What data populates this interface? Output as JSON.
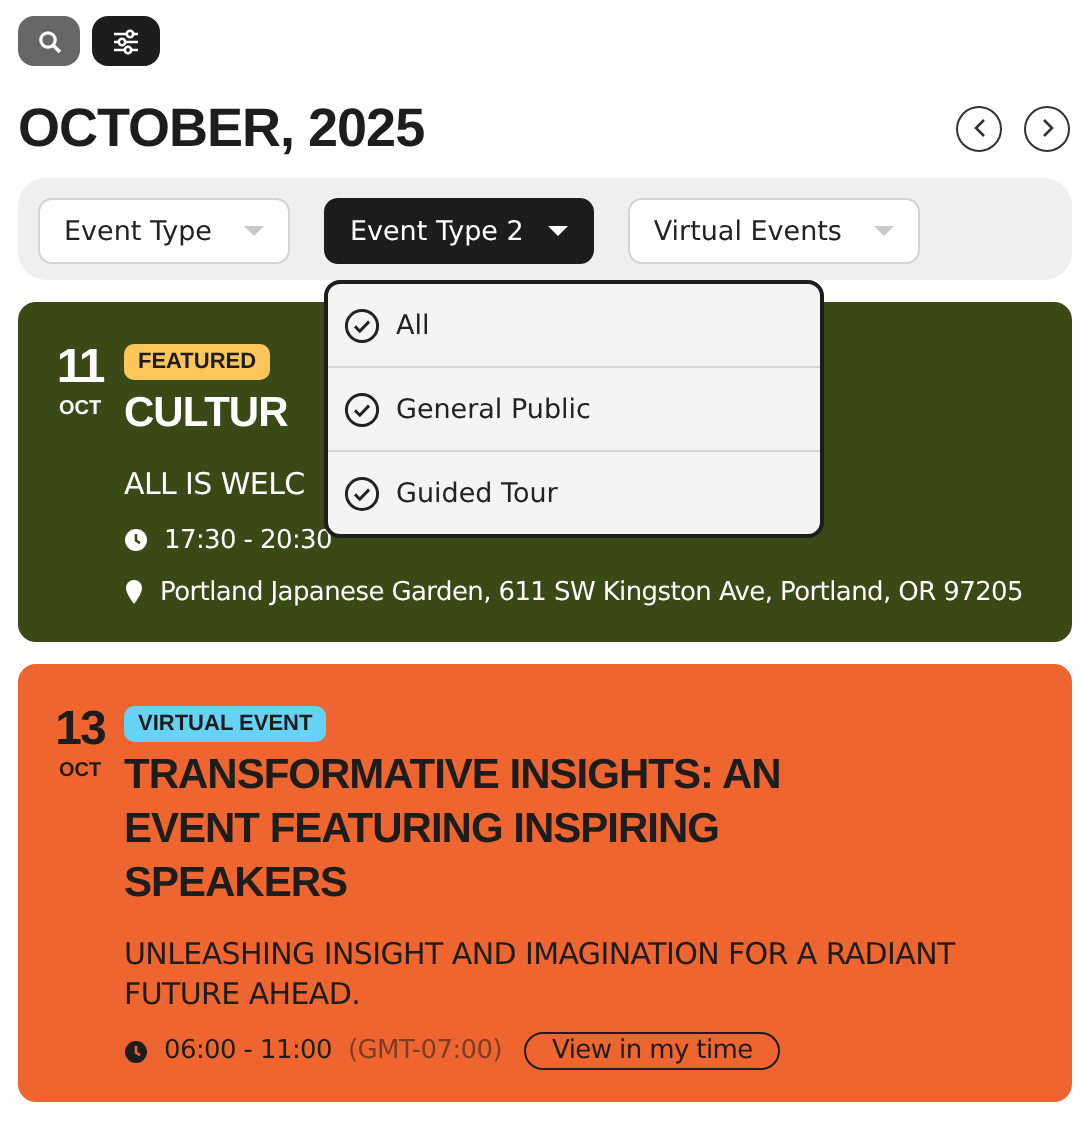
{
  "toolbar": {
    "buttons": [
      {
        "kind": "search",
        "selected": false
      },
      {
        "kind": "filter",
        "selected": true
      }
    ]
  },
  "heading": "OCTOBER, 2025",
  "filters": [
    {
      "label": "Event Type",
      "selected": false
    },
    {
      "label": "Event Type 2",
      "selected": true
    },
    {
      "label": "Virtual Events",
      "selected": false
    }
  ],
  "dropdown": {
    "items": [
      {
        "label": "All"
      },
      {
        "label": "General Public"
      },
      {
        "label": "Guided Tour"
      }
    ]
  },
  "events": [
    {
      "color": "#3a4916",
      "day": "11",
      "month": "OCT",
      "badge": {
        "label": "FEATURED",
        "color": "#fcc65b"
      },
      "title": "CULTUR",
      "subtitle": "ALL IS WELC",
      "time": "17:30 - 20:30",
      "address": "Portland Japanese Garden, 611 SW Kingston Ave, Portland, OR 97205"
    },
    {
      "color": "#ef652f",
      "day": "13",
      "month": "OCT",
      "badge": {
        "label": "VIRTUAL EVENT",
        "color": "#66d2f5"
      },
      "title": "TRANSFORMATIVE INSIGHTS: AN EVENT FEATURING INSPIRING SPEAKERS",
      "subtitle": "UNLEASHING INSIGHT AND IMAGINATION FOR A RADIANT FUTURE AHEAD.",
      "time": "06:00 - 11:00",
      "timezone": "(GMT-07:00)",
      "button": "View in my time"
    }
  ]
}
